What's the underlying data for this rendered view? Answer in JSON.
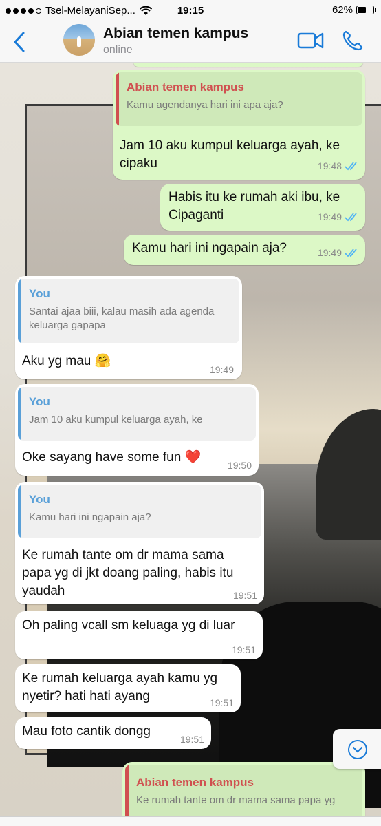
{
  "status_bar": {
    "carrier": "Tsel-MelayaniSep...",
    "time": "19:15",
    "battery": "62%",
    "battery_level": 0.62
  },
  "header": {
    "name": "Abian temen kampus",
    "status": "online"
  },
  "colors": {
    "accent": "#1a7bd8",
    "quote_partner": "#d05050",
    "quote_you": "#5aa0d8",
    "read_ticks": "#4fb3f6"
  },
  "messages": [
    {
      "quote_name": "Abian temen kampus",
      "quote_text": "Kamu agendanya hari ini apa aja?",
      "text": "Jam 10 aku kumpul keluarga ayah, ke cipaku",
      "time": "19:48"
    },
    {
      "text": "Habis itu ke rumah aki ibu, ke Cipaganti",
      "time": "19:49"
    },
    {
      "text": "Kamu hari ini ngapain aja?",
      "time": "19:49"
    },
    {
      "quote_name": "You",
      "quote_text": "Santai ajaa biii, kalau masih ada agenda keluarga gapapa",
      "text": "Aku yg mau 🤗",
      "time": "19:49"
    },
    {
      "quote_name": "You",
      "quote_text": "Jam 10 aku kumpul keluarga ayah, ke",
      "text": "Oke sayang have some fun ❤️",
      "time": "19:50"
    },
    {
      "quote_name": "You",
      "quote_text": "Kamu hari ini ngapain aja?",
      "text": "Ke rumah tante om dr mama sama papa yg di jkt doang paling, habis itu yaudah",
      "time": "19:51"
    },
    {
      "text": "Oh paling vcall sm keluaga yg di luar",
      "time": "19:51"
    },
    {
      "text": "Ke rumah keluarga ayah kamu yg nyetir? hati hati ayang",
      "time": "19:51"
    },
    {
      "text": "Mau foto cantik dongg",
      "time": "19:51"
    },
    {
      "quote_name": "Abian temen kampus",
      "quote_text": "Ke rumah tante om dr mama sama papa yg"
    }
  ],
  "icons": {
    "back": "chevron-left-icon",
    "video": "video-call-icon",
    "call": "phone-icon",
    "scroll": "chevron-down-icon"
  }
}
